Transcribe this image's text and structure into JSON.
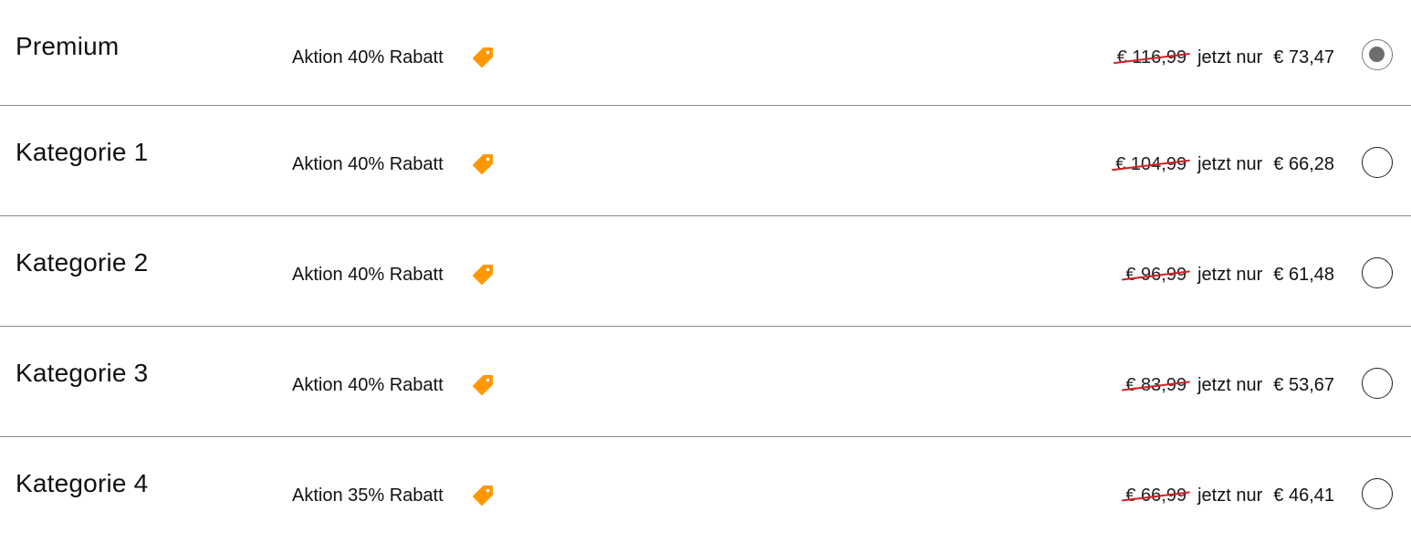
{
  "colors": {
    "tag": "#ff9800",
    "strike": "#d42020",
    "divider": "#8a8a8a",
    "radio_selected_fill": "#6e6e6e"
  },
  "rows": [
    {
      "title": "Premium",
      "promo": "Aktion 40% Rabatt",
      "old_price": "€ 116,99",
      "now_label": "jetzt nur",
      "new_price": "€ 73,47",
      "selected": true
    },
    {
      "title": "Kategorie 1",
      "promo": "Aktion 40% Rabatt",
      "old_price": "€ 104,99",
      "now_label": "jetzt nur",
      "new_price": "€ 66,28",
      "selected": false
    },
    {
      "title": "Kategorie 2",
      "promo": "Aktion 40% Rabatt",
      "old_price": "€ 96,99",
      "now_label": "jetzt nur",
      "new_price": "€ 61,48",
      "selected": false
    },
    {
      "title": "Kategorie 3",
      "promo": "Aktion 40% Rabatt",
      "old_price": "€ 83,99",
      "now_label": "jetzt nur",
      "new_price": "€ 53,67",
      "selected": false
    },
    {
      "title": "Kategorie 4",
      "promo": "Aktion 35% Rabatt",
      "old_price": "€ 66,99",
      "now_label": "jetzt nur",
      "new_price": "€ 46,41",
      "selected": false
    }
  ]
}
